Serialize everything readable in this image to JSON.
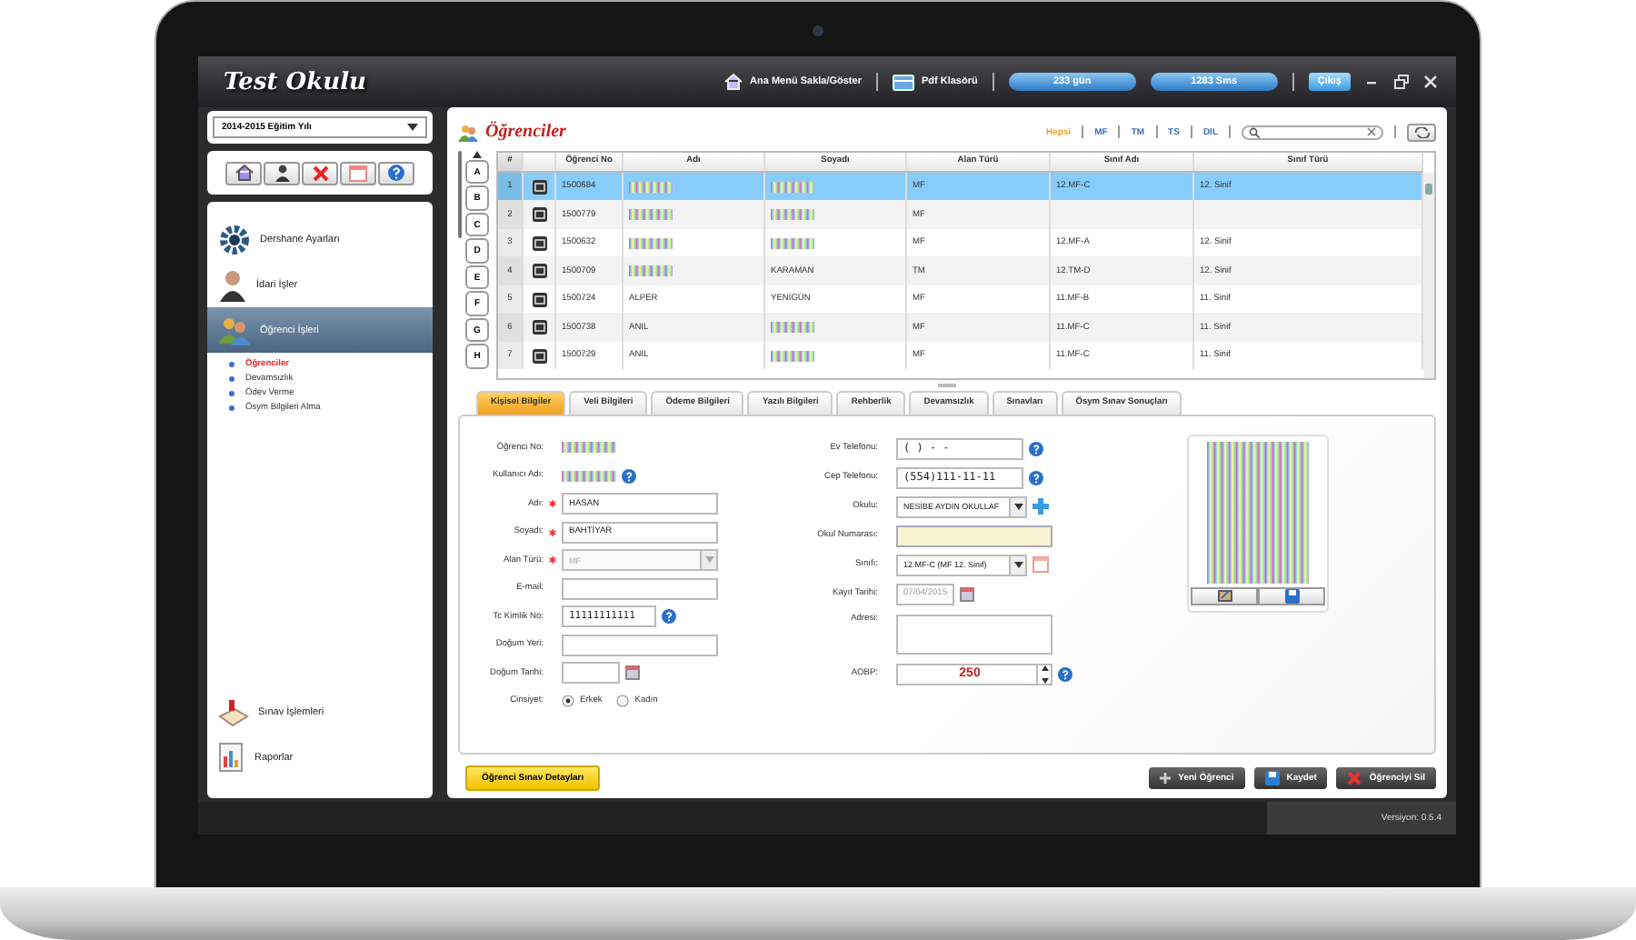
{
  "app": {
    "title": "Test Okulu"
  },
  "topbar": {
    "menu_toggle": "Ana Menü Sakla/Göster",
    "pdf": "Pdf Klasörü",
    "counters": [
      "233 gün",
      "1283 Sms"
    ],
    "logout": "Çıkış"
  },
  "sidebar": {
    "year_select": "2014-2015 Eğitim Yılı",
    "modules": [
      {
        "label": "Dershane Ayarları",
        "selected": false
      },
      {
        "label": "İdari İşler",
        "selected": false
      },
      {
        "label": "Öğrenci İşleri",
        "selected": true,
        "children": [
          {
            "label": "Öğrenciler",
            "selected": true
          },
          {
            "label": "Devamsızlık",
            "selected": false
          },
          {
            "label": "Ödev Verme",
            "selected": false
          },
          {
            "label": "Ösym Bilgileri Alma",
            "selected": false
          }
        ]
      }
    ],
    "bottom_modules": [
      {
        "label": "Sınav İşlemleri",
        "selected": false
      },
      {
        "label": "Raporlar",
        "selected": false
      }
    ]
  },
  "list": {
    "title": "Öğrenciler",
    "filters": [
      {
        "label": "Hepsi",
        "selected": true
      },
      {
        "label": "MF",
        "selected": false
      },
      {
        "label": "TM",
        "selected": false
      },
      {
        "label": "TS",
        "selected": false
      },
      {
        "label": "DIL",
        "selected": false
      }
    ],
    "letters": [
      "A",
      "B",
      "C",
      "D",
      "E",
      "F",
      "G",
      "H"
    ],
    "columns": [
      "#",
      "Öğrenci No",
      "Adı",
      "Soyadı",
      "Alan Türü",
      "Sınıf Adı",
      "Sınıf Türü"
    ],
    "rows": [
      {
        "num": "1",
        "student_no": "1500684",
        "field": "MF",
        "class": "12.MF-C",
        "class_type": "12. Sinif",
        "selected": true
      },
      {
        "num": "2",
        "student_no": "1500779",
        "field": "MF",
        "selected": false
      },
      {
        "num": "3",
        "student_no": "1500632",
        "field": "MF",
        "class": "12.MF-A",
        "class_type": "12. Sinif",
        "selected": false
      },
      {
        "num": "4",
        "student_no": "1500709",
        "surname": "KARAMAN",
        "field": "TM",
        "class": "12.TM-D",
        "class_type": "12. Sinif",
        "selected": false
      },
      {
        "num": "5",
        "student_no": "1500724",
        "name": "ALPER",
        "surname": "YENİGÜN",
        "field": "MF",
        "class": "11.MF-B",
        "class_type": "11. Sinif",
        "selected": false
      },
      {
        "num": "6",
        "student_no": "1500738",
        "name": "ANIL",
        "field": "MF",
        "class": "11.MF-C",
        "class_type": "11. Sinif",
        "selected": false
      },
      {
        "num": "7",
        "student_no": "1500729",
        "name": "ANIL",
        "field": "MF",
        "class": "11.MF-C",
        "class_type": "11. Sinif",
        "selected": false
      }
    ]
  },
  "tabs": [
    {
      "label": "Kişisel Bilgiler",
      "selected": true
    },
    {
      "label": "Veli Bilgileri",
      "selected": false
    },
    {
      "label": "Ödeme Bilgileri",
      "selected": false
    },
    {
      "label": "Yazılı Bilgileri",
      "selected": false
    },
    {
      "label": "Rehberlik",
      "selected": false
    },
    {
      "label": "Devamsızlık",
      "selected": false
    },
    {
      "label": "Sınavları",
      "selected": false
    },
    {
      "label": "Ösym Sınav Sonuçları",
      "selected": false
    }
  ],
  "form": {
    "left": [
      {
        "label": "Öğrenci No:",
        "kind": "hidden",
        "required": false,
        "help": false
      },
      {
        "label": "Kullanıcı Adı:",
        "kind": "hidden",
        "required": false,
        "help": true
      },
      {
        "label": "Adı:",
        "kind": "text",
        "value": "HASAN",
        "required": true,
        "help": false
      },
      {
        "label": "Soyadı:",
        "kind": "text",
        "value": "BAHTİYAR",
        "required": true,
        "help": false
      },
      {
        "label": "Alan Türü:",
        "kind": "select",
        "value": "MF",
        "disabled": true,
        "required": true,
        "help": false
      },
      {
        "label": "E-mail:",
        "kind": "text",
        "required": false,
        "help": false
      },
      {
        "label": "Tc Kimlik No:",
        "kind": "mono",
        "value": "11111111111",
        "required": false,
        "help": true
      },
      {
        "label": "Doğum Yeri:",
        "kind": "text",
        "required": false,
        "help": false
      },
      {
        "label": "Doğum Tarihi:",
        "kind": "date",
        "required": false,
        "help": false
      },
      {
        "label": "Cinsiyet:",
        "kind": "radio",
        "options": [
          {
            "label": "Erkek",
            "selected": true
          },
          {
            "label": "Kadın",
            "selected": false
          }
        ],
        "required": false,
        "help": false
      }
    ],
    "right": [
      {
        "label": "Ev Telefonu:",
        "kind": "mono",
        "value": "(   )   -  -",
        "required": false,
        "help": true
      },
      {
        "label": "Cep Telefonu:",
        "kind": "mono",
        "value": "(554)111-11-11",
        "required": false,
        "help": true
      },
      {
        "label": "Okulu:",
        "kind": "select",
        "value": "NESİBE AYDIN OKULLAF",
        "disabled": false,
        "add_button": true,
        "required": false,
        "help": false
      },
      {
        "label": "Okul Numarası:",
        "kind": "highlight",
        "required": false,
        "help": false
      },
      {
        "label": "Sınıfı:",
        "kind": "select",
        "value": "12.MF-C (MF 12. Sinif)",
        "disabled": false,
        "calendar_button": true,
        "required": false,
        "help": false
      },
      {
        "label": "Kayıt Tarihi:",
        "kind": "date",
        "value": "07/04/2015",
        "disabled": true,
        "required": false,
        "help": false
      },
      {
        "label": "Adresi:",
        "kind": "textarea",
        "required": false,
        "help": false
      },
      {
        "label": "AOBP:",
        "kind": "spinner",
        "value": "250",
        "required": false,
        "help": true
      }
    ]
  },
  "exam_details_button": "Öğrenci Sınav Detayları",
  "actions": [
    {
      "label": "Yeni Öğrenci",
      "kind": "add"
    },
    {
      "label": "Kaydet",
      "kind": "save"
    },
    {
      "label": "Öğrenciyi Sil",
      "kind": "delete"
    }
  ],
  "status_bar": {
    "version": "Versiyon: 0.5.4"
  }
}
